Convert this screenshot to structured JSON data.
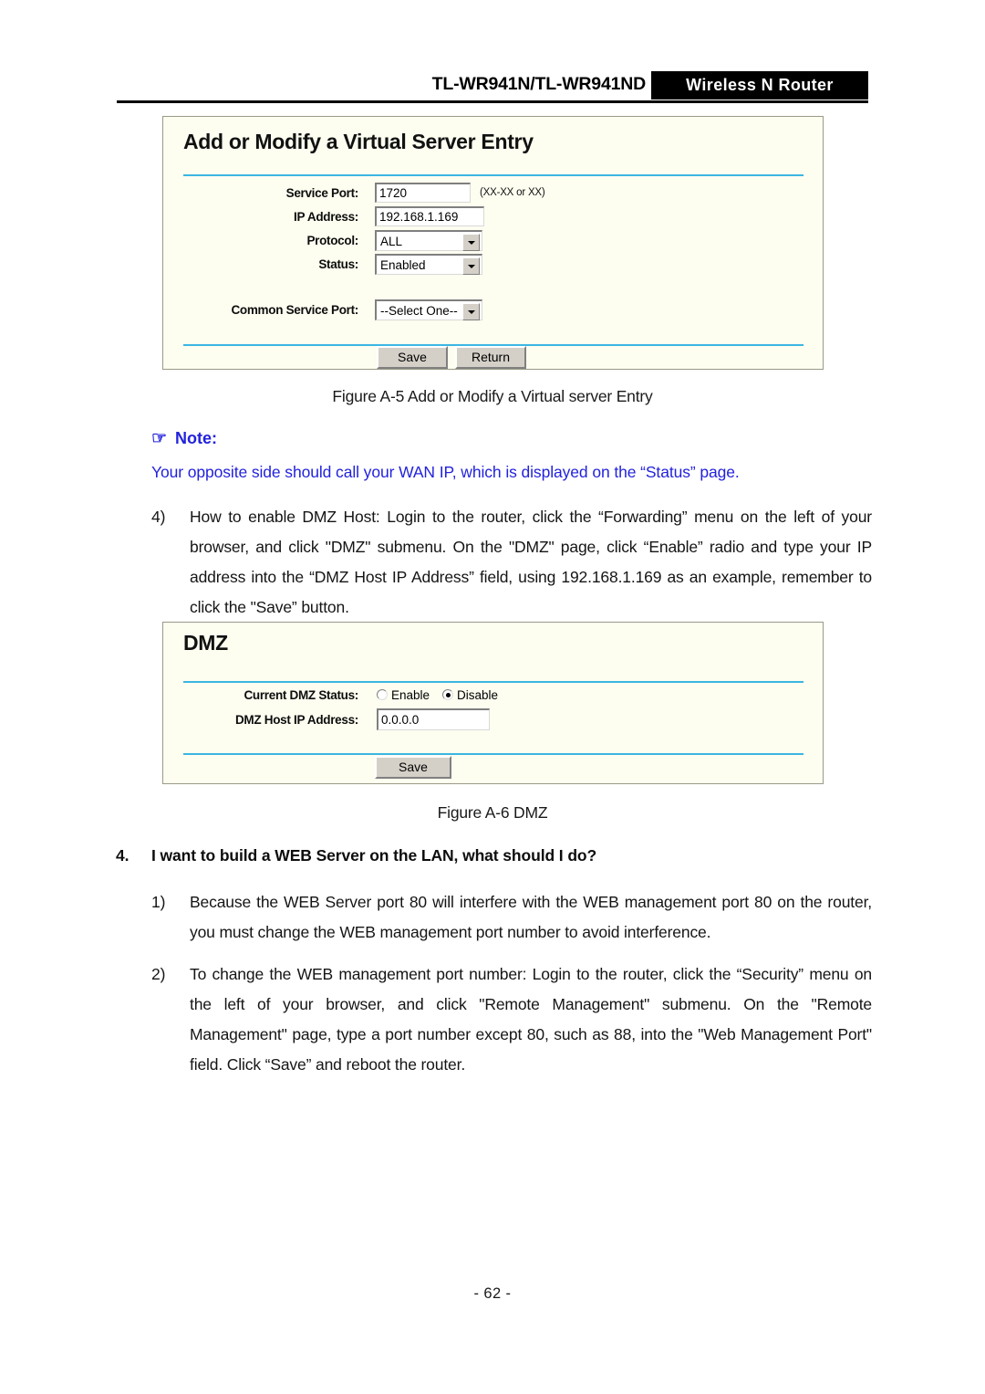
{
  "header": {
    "model": "TL-WR941N/TL-WR941ND",
    "banner": "Wireless  N  Router"
  },
  "virtual_server_panel": {
    "title": "Add or Modify a Virtual Server Entry",
    "fields": {
      "service_port_label": "Service Port:",
      "service_port_value": "1720",
      "service_port_hint": "(XX-XX or XX)",
      "ip_address_label": "IP Address:",
      "ip_address_value": "192.168.1.169",
      "protocol_label": "Protocol:",
      "protocol_value": "ALL",
      "status_label": "Status:",
      "status_value": "Enabled",
      "common_service_port_label": "Common Service Port:",
      "common_service_port_value": "--Select One--"
    },
    "buttons": {
      "save": "Save",
      "return": "Return"
    }
  },
  "figure_a5_caption": "Figure A-5    Add or Modify a Virtual server Entry",
  "note": {
    "icon": "pointing-hand-icon",
    "heading": "Note:",
    "text": "Your opposite side should call your WAN IP, which is displayed on the “Status” page."
  },
  "item_4": {
    "marker": "4)",
    "text": "How to enable DMZ Host: Login to the router, click the “Forwarding” menu on the left of your browser, and click \"DMZ\" submenu. On the \"DMZ\" page, click “Enable” radio and type your IP address into the “DMZ Host IP Address” field, using 192.168.1.169 as an example, remember to click the \"Save” button."
  },
  "dmz_panel": {
    "title": "DMZ",
    "fields": {
      "status_label": "Current DMZ Status:",
      "enable_label": "Enable",
      "disable_label": "Disable",
      "selected": "Disable",
      "host_ip_label": "DMZ Host IP Address:",
      "host_ip_value": "0.0.0.0"
    },
    "buttons": {
      "save": "Save"
    }
  },
  "figure_a6_caption": "Figure A-6    DMZ",
  "question_4": {
    "marker": "4.",
    "text": "I want to build a WEB Server on the LAN, what should I do?"
  },
  "item_1": {
    "marker": "1)",
    "text": "Because the WEB Server port 80 will interfere with the WEB management port 80 on the router, you must change the WEB management port number to avoid interference."
  },
  "item_2": {
    "marker": "2)",
    "text": "To change the WEB management port number: Login to the router, click the “Security” menu on the left of your browser, and click \"Remote Management\" submenu. On the \"Remote Management\" page, type a port number except 80, such as 88, into the \"Web Management Port\" field. Click “Save” and reboot the router."
  },
  "footer": "- 62 -",
  "colors": {
    "panel_bg": "#FDFDF0",
    "rule_blue": "#3CB6E3",
    "note_blue": "#2222DD",
    "banner_bg": "#000000",
    "control_face": "#D4D0C8"
  }
}
